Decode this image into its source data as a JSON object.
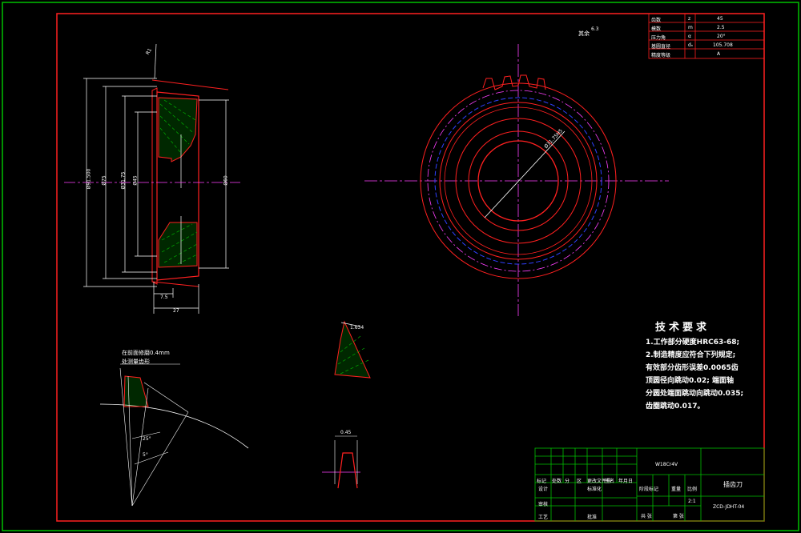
{
  "drawing": {
    "tech_requirements": {
      "title": "技术要求",
      "lines": [
        "1.工作部分硬度HRC63-68;",
        "2.制造精度应符合下列规定;",
        "有效部分齿形误差0.0065齿",
        "顶圆径向跳动0.02; 端面轴",
        "分圆处端面跳动向跳动0.035;",
        "齿圈跳动0.017。"
      ]
    },
    "param_table": {
      "rows": [
        {
          "name": "齿数",
          "sym": "z",
          "val": "45"
        },
        {
          "name": "模数",
          "sym": "m",
          "val": "2.5"
        },
        {
          "name": "压力角",
          "sym": "α",
          "val": "20°"
        },
        {
          "name": "基圆直径",
          "sym": "dₙ",
          "val": "105.708"
        },
        {
          "name": "精度等级",
          "sym": "",
          "val": "A"
        }
      ]
    },
    "title_block": {
      "material": "W18Cr4V",
      "part_name": "插齿刀",
      "drawing_no": "ZCD-JDHT-04",
      "scale": "2:1",
      "headers": [
        "标记",
        "处数",
        "分",
        "区",
        "更改文件号",
        "签名",
        "年月日"
      ],
      "row_design": "设计",
      "row_standard": "标准化",
      "row_review": "审核",
      "row_process": "工艺",
      "row_approve": "批准",
      "stage_mark": "阶段标记",
      "weight": "重量",
      "ratio": "比例",
      "total": "共 张",
      "sheet": "第 张"
    },
    "annotations": {
      "other_roughness": "其余",
      "roughness_value": "6.3",
      "section_note_1": "在前面修磨0.4mm",
      "section_note_2": "处测量齿形",
      "dim_d1": "Ø91.500",
      "dim_d2": "Ø75",
      "dim_d3": "Ø31.75",
      "dim_d4": "Ø45",
      "dim_d5": "Ø60",
      "dim_w1": "27",
      "dim_w2": "7.5",
      "dim_ang": "25°",
      "dim_ang2": "5°",
      "dim_r": "R1",
      "dim_bore": "Ø31.75H5",
      "dim_slot": "0.45",
      "dim_tooth": "1.634"
    }
  }
}
